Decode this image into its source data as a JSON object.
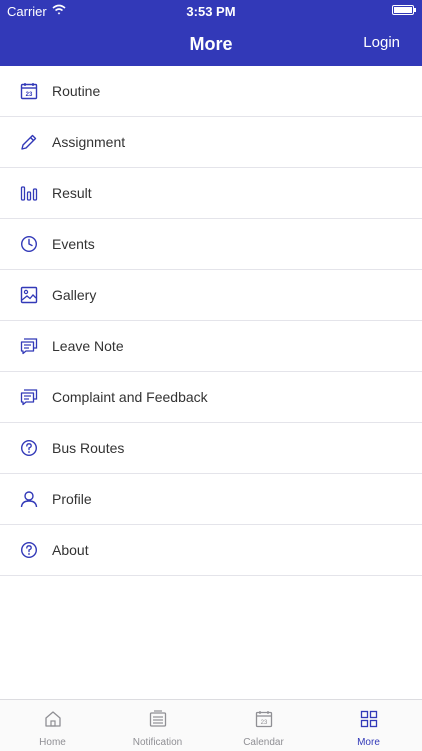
{
  "status_bar": {
    "carrier": "Carrier",
    "time": "3:53 PM"
  },
  "header": {
    "title": "More",
    "login_label": "Login"
  },
  "menu": {
    "items": [
      {
        "label": "Routine",
        "icon": "calendar-icon"
      },
      {
        "label": "Assignment",
        "icon": "pencil-icon"
      },
      {
        "label": "Result",
        "icon": "bar-chart-icon"
      },
      {
        "label": "Events",
        "icon": "clock-icon"
      },
      {
        "label": "Gallery",
        "icon": "image-icon"
      },
      {
        "label": "Leave Note",
        "icon": "chat-icon"
      },
      {
        "label": "Complaint and Feedback",
        "icon": "chat-icon"
      },
      {
        "label": "Bus Routes",
        "icon": "help-icon"
      },
      {
        "label": "Profile",
        "icon": "user-icon"
      },
      {
        "label": "About",
        "icon": "help-icon"
      }
    ]
  },
  "tabbar": {
    "tabs": [
      {
        "label": "Home",
        "icon": "home-icon"
      },
      {
        "label": "Notification",
        "icon": "notification-icon"
      },
      {
        "label": "Calendar",
        "icon": "calendar-icon"
      },
      {
        "label": "More",
        "icon": "grid-icon",
        "active": true
      }
    ]
  },
  "colors": {
    "accent": "#3239b8",
    "inactive": "#8f8f94"
  }
}
